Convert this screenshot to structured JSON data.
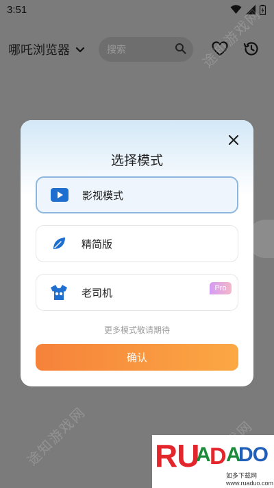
{
  "status_bar": {
    "time": "3:51",
    "icons": [
      "wifi-icon",
      "signal-icon",
      "battery-icon"
    ]
  },
  "app_bar": {
    "title": "哪吒浏览器",
    "search_placeholder": "搜索",
    "icons": [
      "chevron-down-icon",
      "search-icon",
      "heart-icon",
      "history-icon"
    ]
  },
  "dialog": {
    "title": "选择模式",
    "options": [
      {
        "label": "影视模式",
        "icon": "play-icon",
        "selected": true
      },
      {
        "label": "精简版",
        "icon": "leaf-icon",
        "selected": false
      },
      {
        "label": "老司机",
        "icon": "shirt-icon",
        "selected": false,
        "badge": "Pro"
      }
    ],
    "coming_soon": "更多模式敬请期待",
    "confirm_label": "确认",
    "close_icon": "close-icon"
  },
  "watermark_text": "途知游戏网",
  "logo": {
    "text": "RUADADO",
    "subtitle": "如多下载网 www.ruaduo.com"
  },
  "colors": {
    "overlay_background": "#7b7b7b",
    "selected_border": "#8db6de",
    "confirm_gradient_start": "#f6823a",
    "confirm_gradient_end": "#fba844",
    "icon_blue": "#1f6fd1",
    "pro_badge": "#d39cf3"
  }
}
